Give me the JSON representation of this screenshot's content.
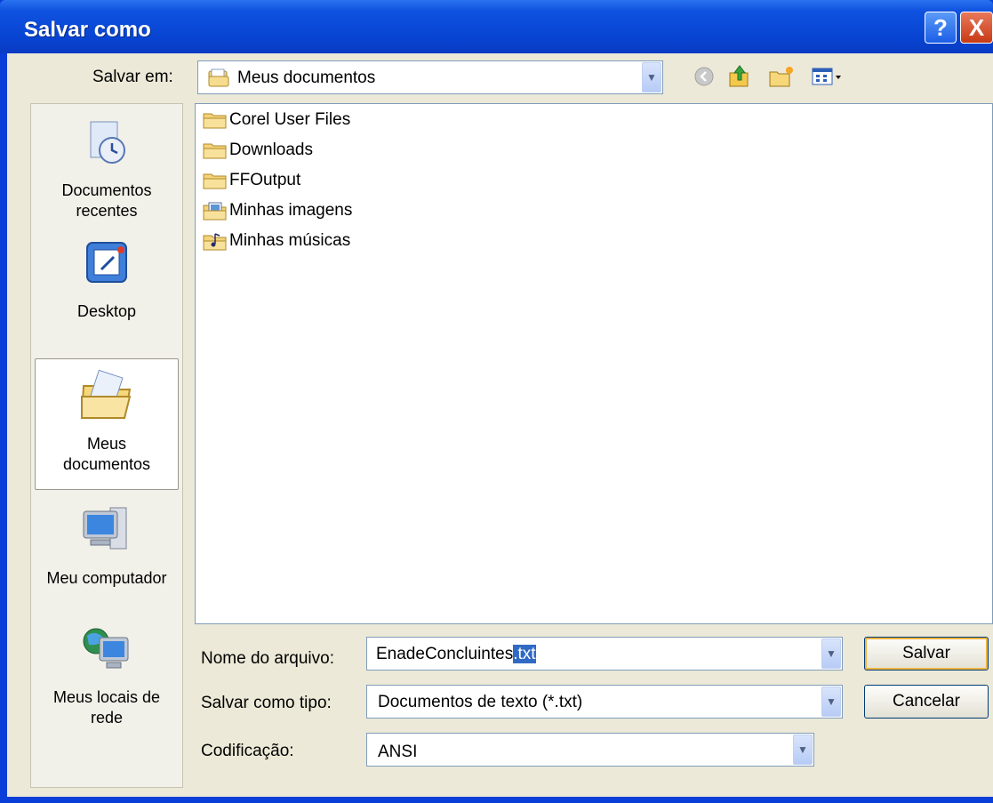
{
  "window": {
    "title": "Salvar como"
  },
  "titlebar_buttons": {
    "help": "?",
    "close": "X"
  },
  "save_in": {
    "label": "Salvar em:",
    "value": "Meus documentos"
  },
  "toolbar_icons": [
    "back-icon",
    "up-folder-icon",
    "new-folder-icon",
    "view-menu-icon"
  ],
  "places": [
    {
      "label_line1": "Documentos",
      "label_line2": "recentes",
      "icon": "recent-documents-icon"
    },
    {
      "label_line1": "Desktop",
      "label_line2": "",
      "icon": "desktop-icon"
    },
    {
      "label_line1": "Meus",
      "label_line2": "documentos",
      "icon": "my-documents-icon"
    },
    {
      "label_line1": "Meu computador",
      "label_line2": "",
      "icon": "my-computer-icon"
    },
    {
      "label_line1": "Meus locais de",
      "label_line2": "rede",
      "icon": "network-places-icon"
    }
  ],
  "files": [
    {
      "name": "Corel User Files",
      "icon": "folder-icon"
    },
    {
      "name": "Downloads",
      "icon": "folder-icon"
    },
    {
      "name": "FFOutput",
      "icon": "folder-icon"
    },
    {
      "name": "Minhas imagens",
      "icon": "pictures-folder-icon"
    },
    {
      "name": "Minhas músicas",
      "icon": "music-folder-icon"
    }
  ],
  "filename": {
    "label": "Nome do arquivo:",
    "value_main": "EnadeConcluintes",
    "value_selected": ".txt"
  },
  "filetype": {
    "label": "Salvar como tipo:",
    "value": "Documentos de texto (*.txt)"
  },
  "encoding": {
    "label": "Codificação:",
    "value": "ANSI"
  },
  "buttons": {
    "save": "Salvar",
    "cancel": "Cancelar"
  },
  "colors": {
    "titlebar": "#0a47d6",
    "dialog_bg": "#ece9d8",
    "selection": "#316ac5"
  }
}
